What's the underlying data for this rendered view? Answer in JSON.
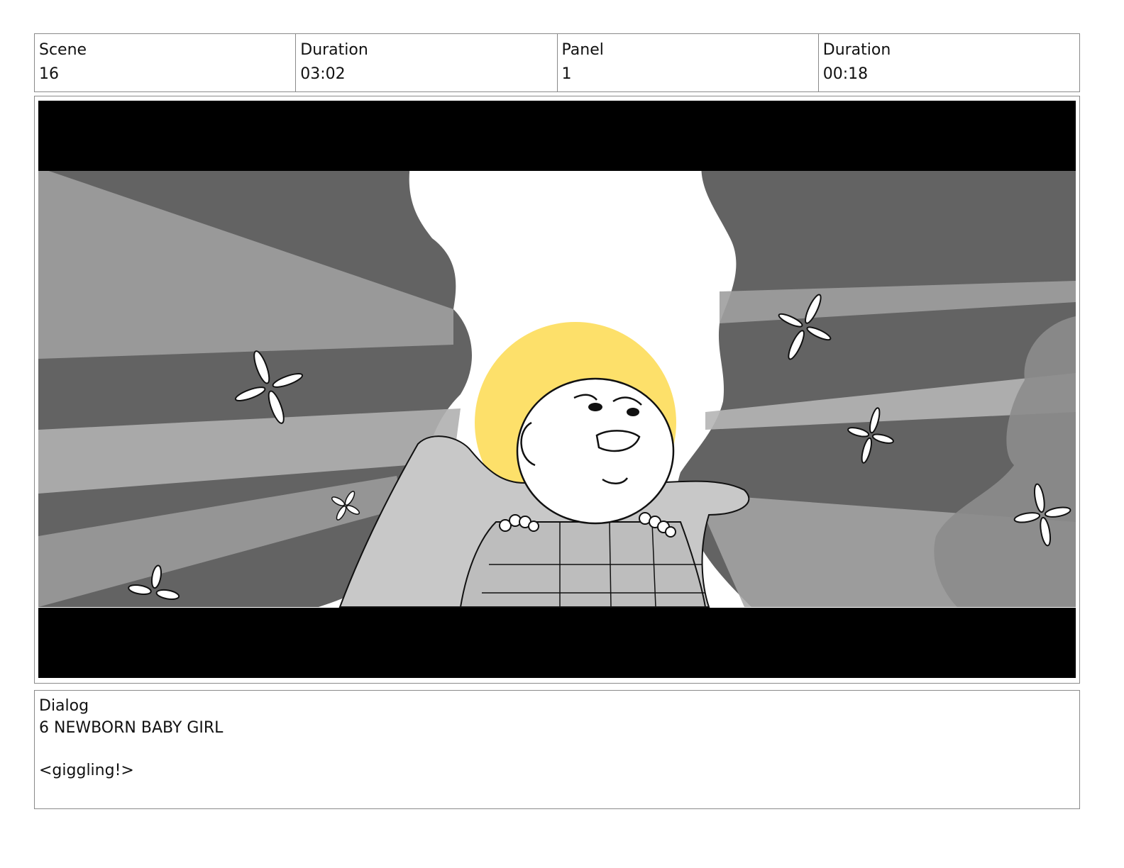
{
  "header": {
    "scene_label": "Scene",
    "scene_value": "16",
    "scene_duration_label": "Duration",
    "scene_duration_value": "03:02",
    "panel_label": "Panel",
    "panel_value": "1",
    "panel_duration_label": "Duration",
    "panel_duration_value": "00:18"
  },
  "panel_image": {
    "colors": {
      "letterbox": "#000000",
      "sky": "#ffffff",
      "halo": "#fde06a",
      "foliage_dark": "#636363",
      "foliage_mid": "#8c8c8c",
      "light_ray": "#b5b5b5",
      "baby_body": "#c8c8c8"
    },
    "icons": [
      "firefly-icon",
      "firefly-icon",
      "firefly-icon",
      "firefly-icon",
      "firefly-icon",
      "firefly-icon"
    ]
  },
  "dialog": {
    "label": "Dialog",
    "character": "6 NEWBORN BABY GIRL",
    "line": "<giggling!>"
  }
}
